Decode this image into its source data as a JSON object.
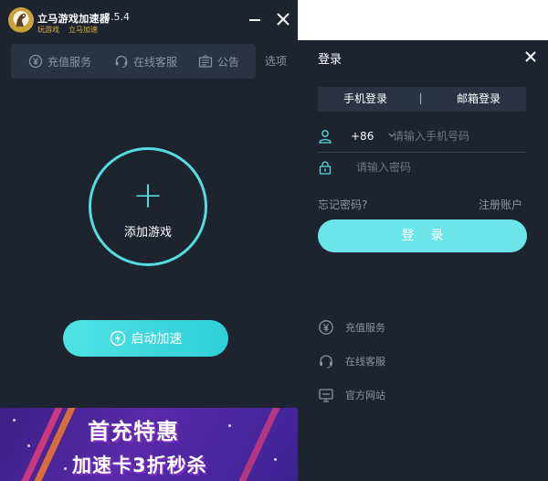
{
  "app": {
    "title": "立马游戏加速器",
    "version": "3.5.4",
    "sub_left": "玩游戏",
    "sub_right": "立马加速",
    "minimize_icon": "—",
    "close_icon": "✕"
  },
  "nav": {
    "items": [
      {
        "label": "充值服务",
        "icon": "yen-circle-icon"
      },
      {
        "label": "在线客服",
        "icon": "headset-icon"
      },
      {
        "label": "公告",
        "icon": "notice-icon"
      }
    ],
    "options_label": "选项"
  },
  "main": {
    "add_plus": "+",
    "add_game_label": "添加游戏",
    "start_label": "启动加速"
  },
  "banner": {
    "line1": "首充特惠",
    "line2": "加速卡3折秒杀"
  },
  "login": {
    "title": "登录",
    "close_icon": "✕",
    "tabs": {
      "phone": "手机登录",
      "email": "邮箱登录"
    },
    "country_code": "+86",
    "phone_placeholder": "请输入手机号码",
    "password_placeholder": "请输入密码",
    "forgot": "忘记密码?",
    "register": "注册账户",
    "submit": "登录",
    "links": [
      {
        "label": "充值服务",
        "icon": "yen-circle-icon"
      },
      {
        "label": "在线客服",
        "icon": "headset-icon"
      },
      {
        "label": "官方网站",
        "icon": "monitor-icon"
      }
    ]
  },
  "colors": {
    "background": "#1e2330",
    "panel": "#2b3244",
    "accent": "#55dcdf",
    "muted_text": "#8a93a7",
    "brand_gold": "#d6b33e"
  }
}
